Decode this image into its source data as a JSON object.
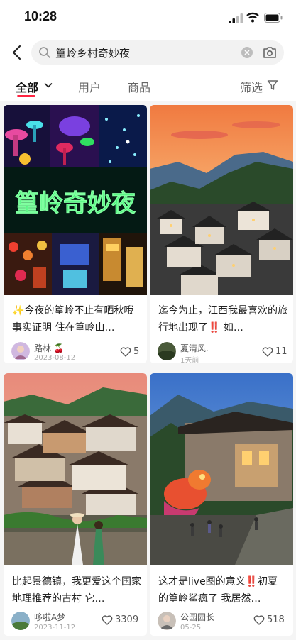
{
  "status": {
    "time": "10:28"
  },
  "search": {
    "query": "篁岭乡村奇妙夜"
  },
  "tabs": [
    {
      "label": "全部"
    },
    {
      "label": "用户"
    },
    {
      "label": "商品"
    }
  ],
  "filter_label": "筛选",
  "colors": {
    "accent": "#ff2442",
    "bg": "#f5f5f5"
  },
  "cards": [
    {
      "title": "✨今夜的篁岭不止有晒秋哦 事实证明 住在篁岭山…",
      "user": "路林 🍒",
      "date": "2023-08-12",
      "likes": "5",
      "image_text": "篁岭奇妙夜"
    },
    {
      "title": "迄今为止，江西我最喜欢的旅行地出现了‼️ 如…",
      "user": "夏清风.",
      "date": "1天前",
      "likes": "11"
    },
    {
      "title": "比起景德镇，我更爱这个国家地理推荐的古村 它…",
      "user": "哆啦A梦",
      "date": "2023-11-12",
      "likes": "3309"
    },
    {
      "title": "这才是live图的意义‼️初夏的篁岭鲨疯了 我居然…",
      "user": "公园园长",
      "date": "05-25",
      "likes": "518"
    }
  ]
}
